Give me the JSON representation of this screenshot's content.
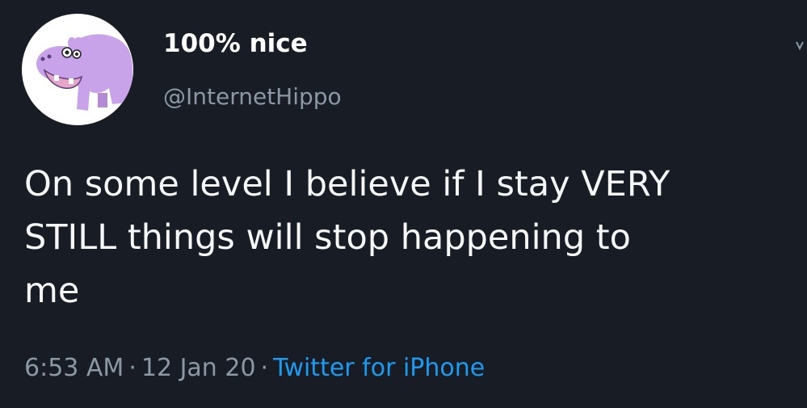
{
  "tweet": {
    "author": {
      "display_name": "100% nice",
      "handle": "@InternetHippo",
      "avatar_icon": "hippo-avatar-icon"
    },
    "text": "On some level I believe if I stay VERY\nSTILL things will stop happening to\nme",
    "meta": {
      "time": "6:53 AM",
      "separator": "·",
      "date": "12 Jan 20",
      "source": "Twitter for iPhone"
    }
  },
  "colors": {
    "background": "#181c24",
    "primary_text": "#f5f7fa",
    "secondary_text": "#8b98a5",
    "link": "#1d9bf0",
    "avatar_hippo": "#c9a3ea"
  }
}
